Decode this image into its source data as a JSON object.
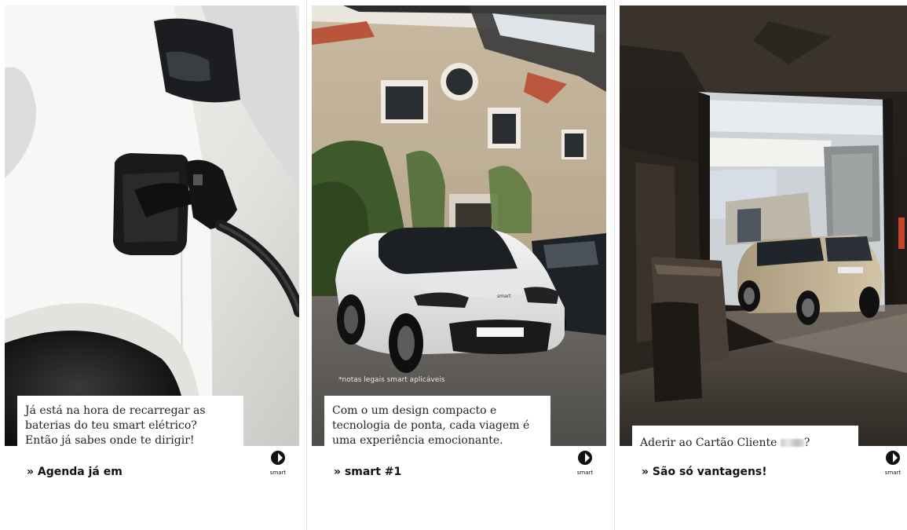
{
  "posts": [
    {
      "caption_lines": [
        "Já está na hora de recarregar as",
        "baterias do teu smart elétrico?",
        "Então já sabes onde te dirigir!"
      ],
      "cta": "» Agenda já em",
      "logo_text": "smart",
      "photo_icon": "ev-charging-photo"
    },
    {
      "legal_note": "*notas legais smart aplicáveis",
      "caption_lines": [
        "Com o um design compacto e",
        "tecnologia de ponta, cada viagem é",
        "uma experiência emocionante."
      ],
      "cta": "» smart #1",
      "logo_text": "smart",
      "photo_icon": "white-suv-courtyard-photo"
    },
    {
      "caption_before": "Aderir ao Cartão Cliente ",
      "caption_after": "?",
      "cta": "» São só vantagens!",
      "logo_text": "smart",
      "photo_icon": "car-in-garage-photo"
    }
  ],
  "colors": {
    "text": "#111111",
    "card_bg": "#ffffff",
    "divider": "#e2e2e2"
  }
}
